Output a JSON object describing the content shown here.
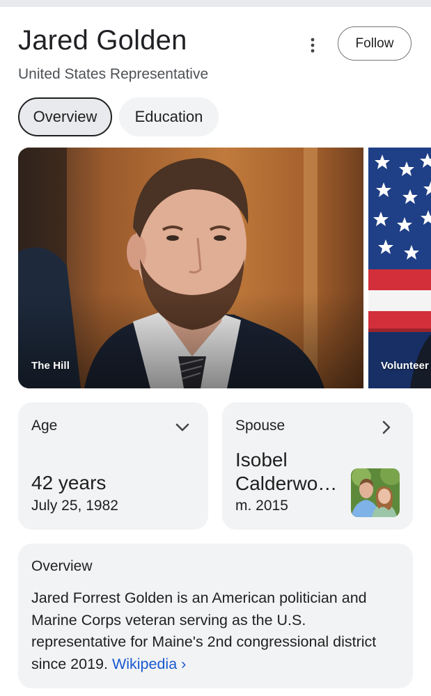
{
  "header": {
    "title": "Jared Golden",
    "subtitle": "United States Representative",
    "follow_label": "Follow",
    "more_icon": "vertical-dots-icon"
  },
  "tabs": [
    {
      "label": "Overview",
      "selected": true
    },
    {
      "label": "Education",
      "selected": false
    }
  ],
  "images": [
    {
      "caption": "The Hill"
    },
    {
      "caption": "Volunteer"
    }
  ],
  "facts": {
    "age": {
      "label": "Age",
      "value": "42 years",
      "date": "July 25, 1982",
      "icon": "chevron-down-icon"
    },
    "spouse": {
      "label": "Spouse",
      "name_line1": "Isobel",
      "name_line2": "Calderwo…",
      "married": "m. 2015",
      "icon": "chevron-right-icon"
    }
  },
  "overview": {
    "title": "Overview",
    "text": "Jared Forrest Golden is an American politician and Marine Corps veteran serving as the U.S. representative for Maine's 2nd congressional district since 2019.",
    "source_link": "Wikipedia",
    "source_arrow": "›"
  },
  "colors": {
    "link": "#1a58d1",
    "card_bg": "#f1f3f4",
    "chip_selected_bg": "#e8eaed"
  }
}
